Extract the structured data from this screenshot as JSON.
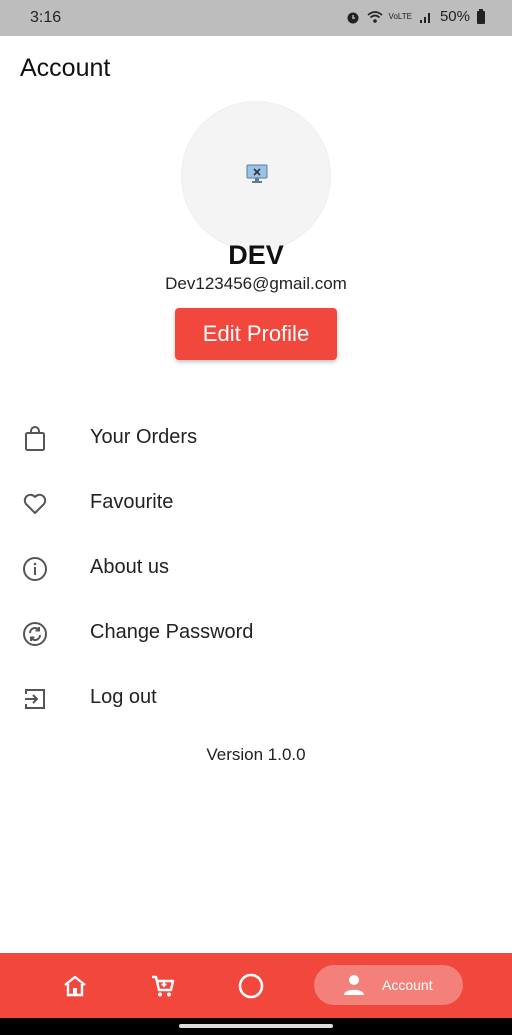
{
  "status_bar": {
    "time": "3:16",
    "battery": "50%",
    "network": "VoLTE"
  },
  "header": {
    "title": "Account"
  },
  "profile": {
    "name": "DEV",
    "email": "Dev123456@gmail.com",
    "edit_label": "Edit Profile"
  },
  "menu": {
    "items": [
      {
        "label": "Your Orders",
        "icon": "shopping-bag-icon"
      },
      {
        "label": "Favourite",
        "icon": "heart-icon"
      },
      {
        "label": "About us",
        "icon": "info-icon"
      },
      {
        "label": "Change Password",
        "icon": "change-password-icon"
      },
      {
        "label": "Log out",
        "icon": "logout-icon"
      }
    ]
  },
  "version": "Version 1.0.0",
  "bottom_nav": {
    "items": [
      {
        "name": "home",
        "icon": "home-icon"
      },
      {
        "name": "cart",
        "icon": "cart-icon"
      },
      {
        "name": "circle",
        "icon": "circle-icon"
      },
      {
        "name": "account",
        "label": "Account",
        "icon": "person-icon",
        "active": true
      }
    ]
  },
  "colors": {
    "accent": "#f2473c",
    "active_pill": "#f4807a",
    "status_bar": "#bdbdbd"
  }
}
